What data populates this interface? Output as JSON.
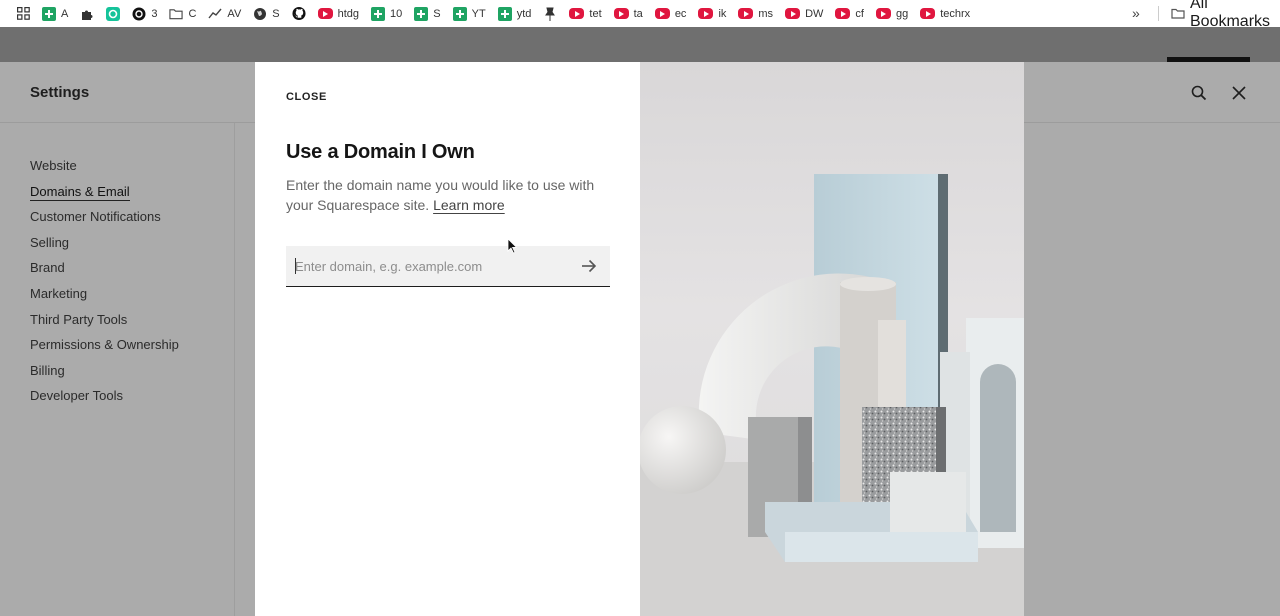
{
  "bookmarks_bar": {
    "items": [
      {
        "label": "",
        "icon": "apps-grid-icon"
      },
      {
        "label": "A",
        "icon": "sheets-icon"
      },
      {
        "label": "",
        "icon": "extension-icon"
      },
      {
        "label": "",
        "icon": "grammarly-icon"
      },
      {
        "label": "3",
        "icon": "threads-icon"
      },
      {
        "label": "C",
        "icon": "folder-icon"
      },
      {
        "label": "AV",
        "icon": "chart-line-icon"
      },
      {
        "label": "S",
        "icon": "globe-icon"
      },
      {
        "label": "",
        "icon": "github-icon"
      },
      {
        "label": "htdg",
        "icon": "youtube-icon"
      },
      {
        "label": "10",
        "icon": "sheets-icon"
      },
      {
        "label": "S",
        "icon": "sheets-icon"
      },
      {
        "label": "YT",
        "icon": "sheets-icon"
      },
      {
        "label": "ytd",
        "icon": "sheets-icon"
      },
      {
        "label": "",
        "icon": "pin-icon"
      },
      {
        "label": "tet",
        "icon": "youtube-icon"
      },
      {
        "label": "ta",
        "icon": "youtube-icon"
      },
      {
        "label": "ec",
        "icon": "youtube-icon"
      },
      {
        "label": "ik",
        "icon": "youtube-icon"
      },
      {
        "label": "ms",
        "icon": "youtube-icon"
      },
      {
        "label": "DW",
        "icon": "youtube-icon"
      },
      {
        "label": "cf",
        "icon": "youtube-icon"
      },
      {
        "label": "gg",
        "icon": "youtube-icon"
      },
      {
        "label": "techrx",
        "icon": "youtube-icon"
      }
    ],
    "overflow_label": "»",
    "all_bookmarks_label": "All Bookmarks"
  },
  "app": {
    "title": "Settings",
    "nav": [
      {
        "label": "Website",
        "active": false
      },
      {
        "label": "Domains & Email",
        "active": true
      },
      {
        "label": "Customer Notifications",
        "active": false
      },
      {
        "label": "Selling",
        "active": false
      },
      {
        "label": "Brand",
        "active": false
      },
      {
        "label": "Marketing",
        "active": false
      },
      {
        "label": "Third Party Tools",
        "active": false
      },
      {
        "label": "Permissions & Ownership",
        "active": false
      },
      {
        "label": "Billing",
        "active": false
      },
      {
        "label": "Developer Tools",
        "active": false
      }
    ]
  },
  "modal": {
    "close_label": "CLOSE",
    "title": "Use a Domain I Own",
    "description": "Enter the domain name you would like to use with your Squarespace site.",
    "learn_more": "Learn more",
    "input_value": "",
    "input_placeholder": "Enter domain, e.g. example.com"
  },
  "colors": {
    "overlay": "#ababab",
    "modal_bg": "#ffffff",
    "field_bg": "#f1f1f1",
    "sheets_green": "#1fa463",
    "youtube_red": "#e0163f"
  }
}
